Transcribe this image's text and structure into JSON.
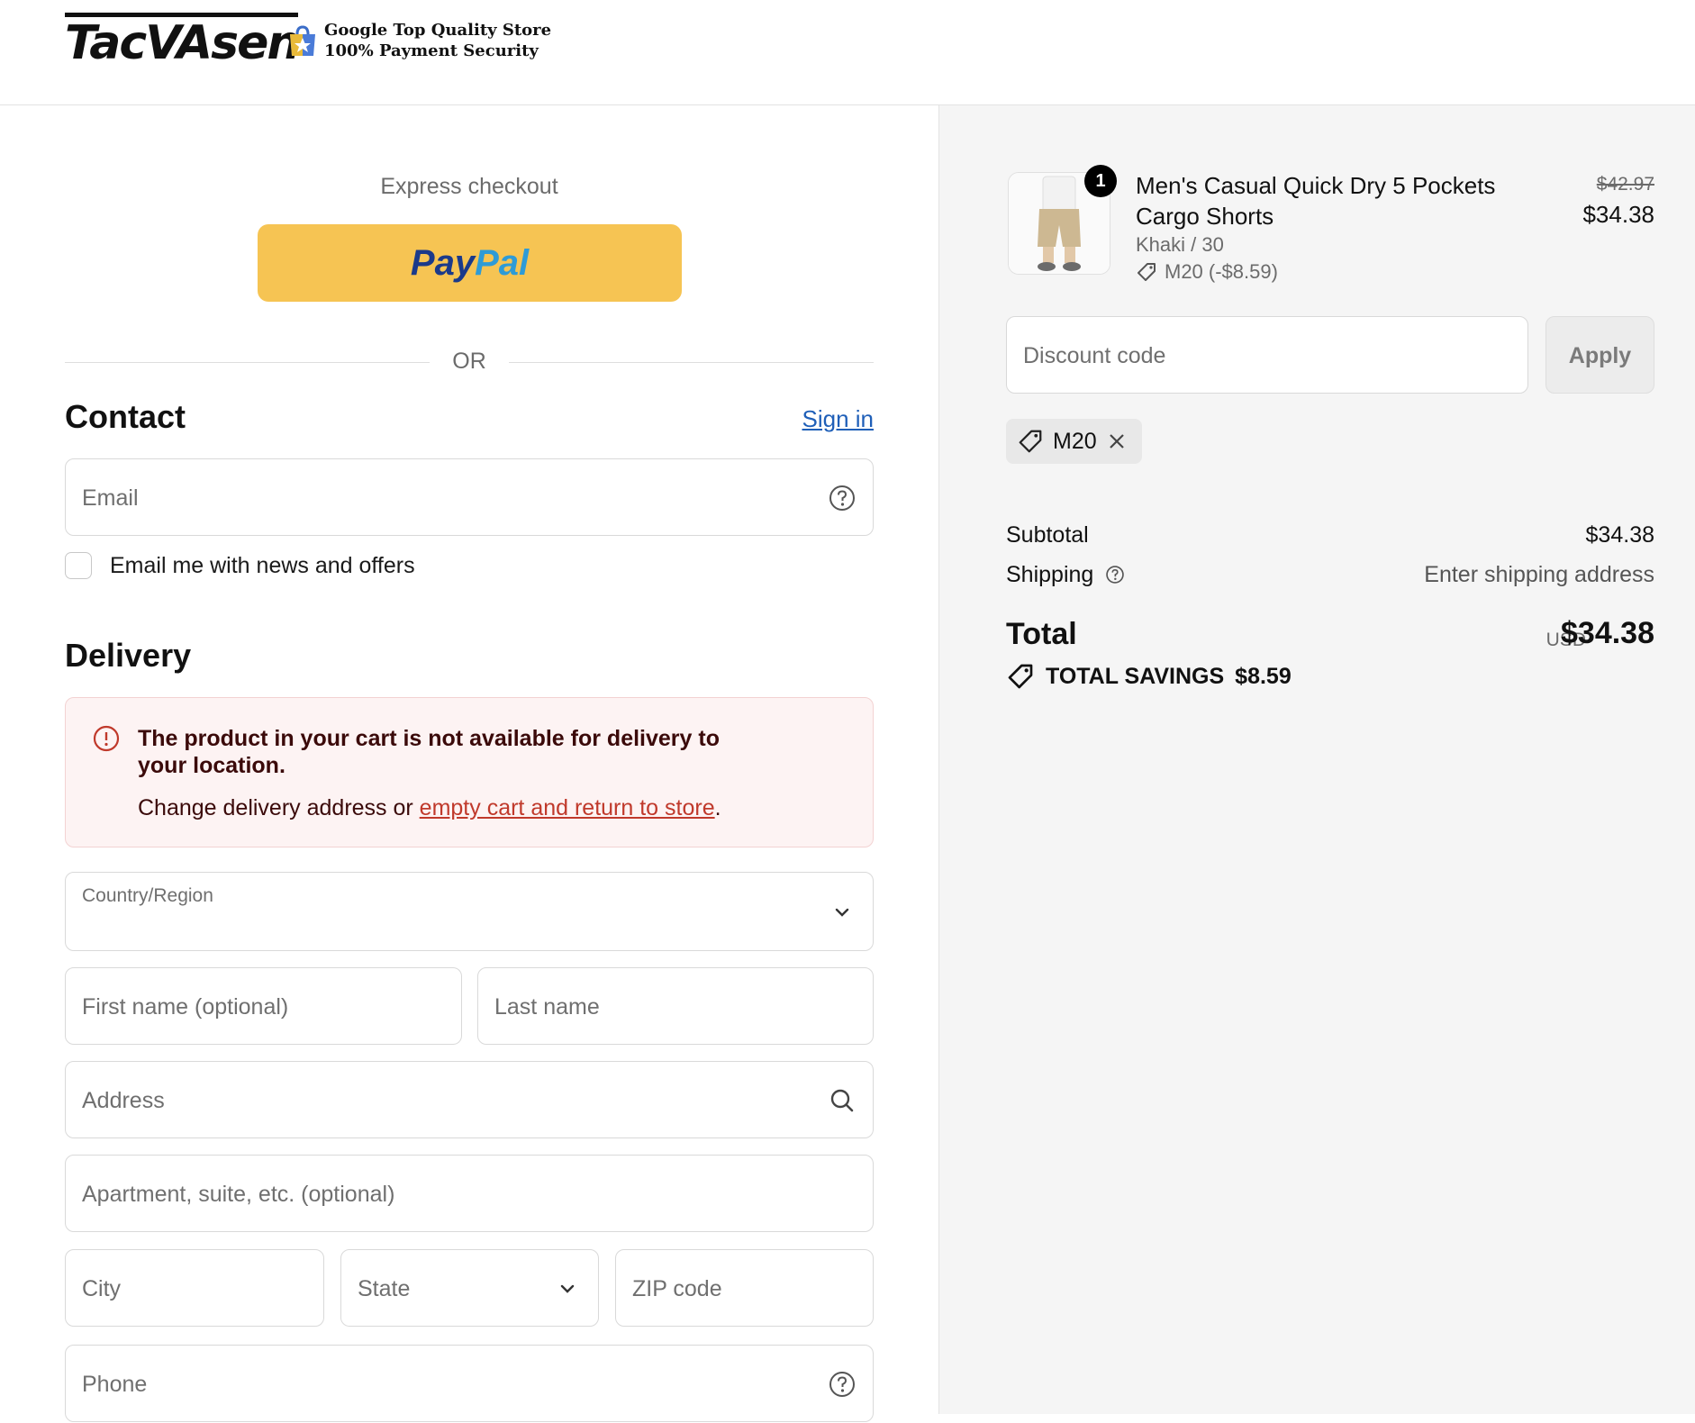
{
  "header": {
    "logo": "TacVAsen",
    "badge_line1": "Google Top Quality Store",
    "badge_line2": "100% Payment Security"
  },
  "checkout": {
    "express_title": "Express checkout",
    "paypal_pay": "Pay",
    "paypal_pal": "Pal",
    "or_text": "OR",
    "contact_title": "Contact",
    "sign_in": "Sign in",
    "email_placeholder": "Email",
    "newsletter_label": "Email me with news and offers",
    "delivery_title": "Delivery",
    "alert": {
      "title": "The product in your cart is not available for delivery to your location.",
      "body_prefix": "Change delivery address or ",
      "link": "empty cart and return to store",
      "body_suffix": "."
    },
    "country_label": "Country/Region",
    "first_name_placeholder": "First name (optional)",
    "last_name_placeholder": "Last name",
    "address_placeholder": "Address",
    "apartment_placeholder": "Apartment, suite, etc. (optional)",
    "city_placeholder": "City",
    "state_placeholder": "State",
    "zip_placeholder": "ZIP code",
    "phone_placeholder": "Phone"
  },
  "summary": {
    "item": {
      "quantity": "1",
      "name": "Men's Casual Quick Dry 5 Pockets Cargo Shorts",
      "variant": "Khaki / 30",
      "discount": "M20 (-$8.59)",
      "price_original": "$42.97",
      "price_final": "$34.38"
    },
    "discount_placeholder": "Discount code",
    "apply_label": "Apply",
    "applied_code": "M20",
    "subtotal_label": "Subtotal",
    "subtotal_value": "$34.38",
    "shipping_label": "Shipping",
    "shipping_value": "Enter shipping address",
    "total_label": "Total",
    "total_currency": "USD",
    "total_value": "$34.38",
    "savings_label": "TOTAL SAVINGS",
    "savings_value": "$8.59"
  },
  "colors": {
    "paypal_button": "#f6c453",
    "link_blue": "#1f5fb8",
    "alert_bg": "#fdf3f3",
    "alert_text": "#3b0a0a",
    "alert_link": "#c0392b",
    "summary_bg": "#f5f5f5"
  }
}
